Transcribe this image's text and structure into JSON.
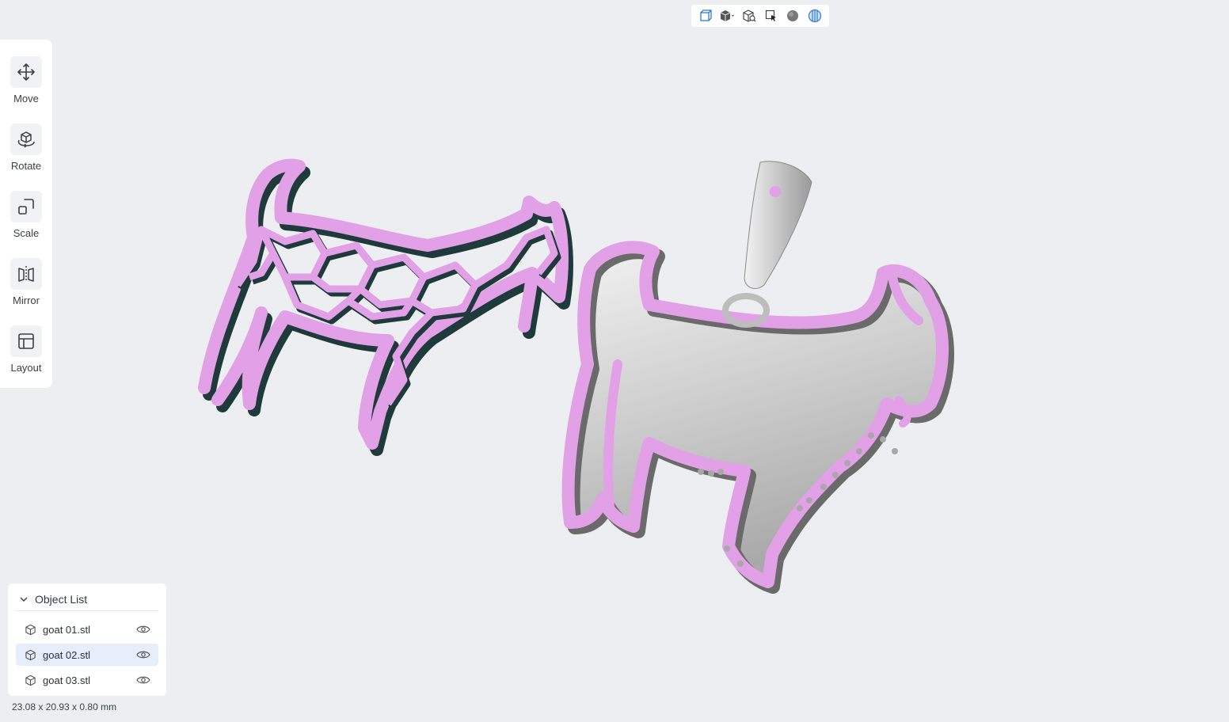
{
  "tools": [
    {
      "id": "move",
      "label": "Move",
      "icon": "move-arrows-icon"
    },
    {
      "id": "rotate",
      "label": "Rotate",
      "icon": "rotate-cube-icon"
    },
    {
      "id": "scale",
      "label": "Scale",
      "icon": "scale-square-icon"
    },
    {
      "id": "mirror",
      "label": "Mirror",
      "icon": "mirror-icon"
    },
    {
      "id": "layout",
      "label": "Layout",
      "icon": "layout-icon"
    }
  ],
  "view_toolbar": [
    {
      "icon": "perspective-view-icon",
      "active": true
    },
    {
      "icon": "view-cube-dropdown-icon",
      "active": false
    },
    {
      "icon": "zoom-fit-icon",
      "active": false
    },
    {
      "icon": "select-box-icon",
      "active": false
    },
    {
      "icon": "shading-sphere-icon",
      "active": false
    },
    {
      "icon": "wireframe-icon",
      "active": true
    }
  ],
  "object_list": {
    "title": "Object List",
    "items": [
      {
        "name": "goat 01.stl",
        "selected": false
      },
      {
        "name": "goat 02.stl",
        "selected": true
      },
      {
        "name": "goat 03.stl",
        "selected": false
      }
    ]
  },
  "dimensions": "23.08 x 20.93 x 0.80 mm",
  "colors": {
    "accent": "#2f7bd9",
    "model_outline": "#e2a0e6",
    "model_body": "#c9c9c9",
    "selected_row": "#e6edfb"
  }
}
